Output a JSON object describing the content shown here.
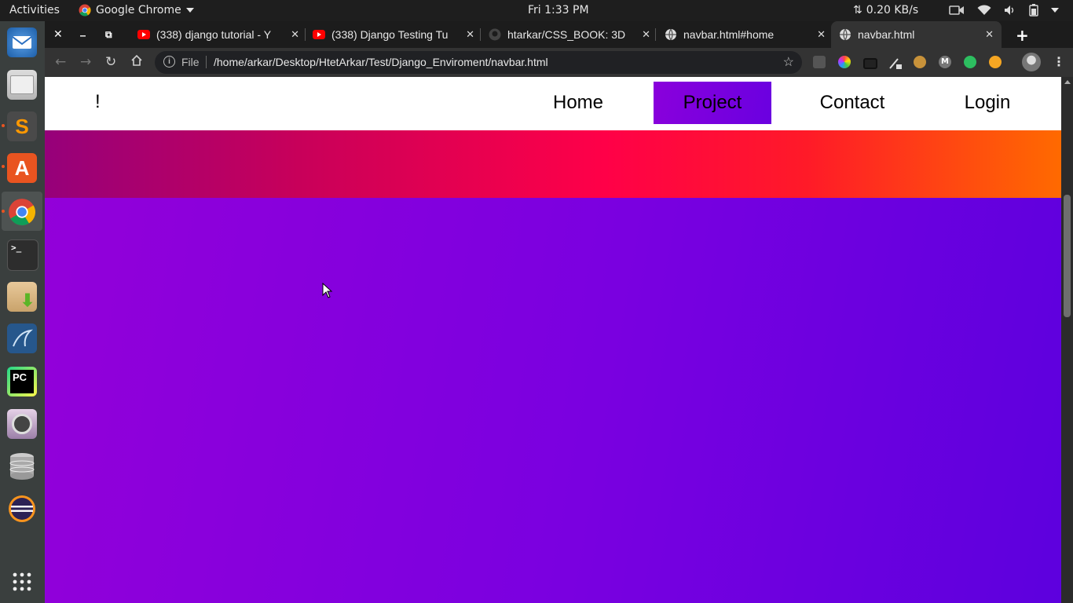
{
  "system_bar": {
    "activities": "Activities",
    "app_name": "Google Chrome",
    "clock": "Fri  1:33 PM",
    "net_speed": "0.20 KB/s"
  },
  "dock": {
    "items": [
      "thunderbird-icon",
      "files-icon",
      "sublime-text-icon",
      "software-center-icon",
      "chrome-icon",
      "terminal-icon",
      "archive-manager-icon",
      "mysql-workbench-icon",
      "pycharm-icon",
      "camera-icon",
      "database-icon",
      "eclipse-icon",
      "app-grid-icon"
    ],
    "active": "chrome-icon"
  },
  "browser": {
    "tabs": [
      {
        "title": "(338) django tutorial - Y",
        "icon": "youtube-icon",
        "favicon_color": "#ff0000"
      },
      {
        "title": "(338) Django Testing Tu",
        "icon": "youtube-icon",
        "favicon_color": "#ff0000"
      },
      {
        "title": "htarkar/CSS_BOOK: 3D",
        "icon": "github-icon",
        "favicon_color": "#444444"
      },
      {
        "title": "navbar.html#home",
        "icon": "globe-icon",
        "favicon_color": "#dddddd"
      },
      {
        "title": "navbar.html",
        "icon": "globe-icon",
        "favicon_color": "#dddddd",
        "active": true
      }
    ],
    "omnibox": {
      "scheme": "File",
      "url": "/home/arkar/Desktop/HtetArkar/Test/Django_Enviroment/navbar.html"
    }
  },
  "page": {
    "brand": "!",
    "nav_links": [
      "Home",
      "Project",
      "Contact",
      "Login"
    ],
    "active_link": "Project",
    "colors": {
      "nav_bg": "#ffffff",
      "active_link_bg": "#7a00e0",
      "banner_start": "#96007a",
      "banner_end": "#ff6a00",
      "body_start": "#9400d9",
      "body_end": "#5d00de"
    }
  }
}
